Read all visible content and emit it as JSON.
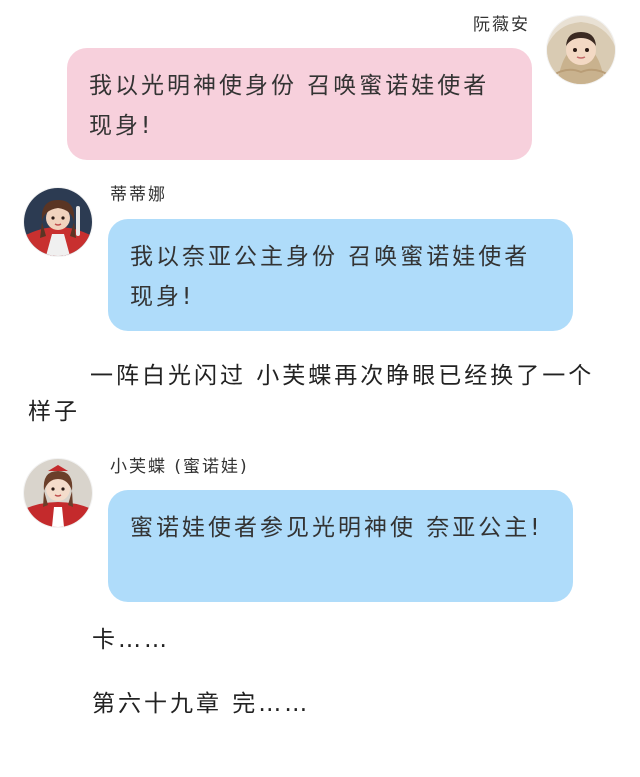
{
  "messages": [
    {
      "sender": "阮薇安",
      "text": "我以光明神使身份 召唤蜜诺娃使者现身!",
      "color": "#f7d0dc"
    },
    {
      "sender": "蒂蒂娜",
      "text": "我以奈亚公主身份 召唤蜜诺娃使者现身!",
      "color": "#afdcfa"
    },
    {
      "sender": "小芙蝶 (蜜诺娃)",
      "text": "蜜诺娃使者参见光明神使 奈亚公主!",
      "color": "#afdcfa"
    }
  ],
  "narration": {
    "transformation": "一阵白光闪过 小芙蝶再次睁眼已经换了一个样子",
    "cut": "卡……",
    "chapter_end": "第六十九章 完……"
  },
  "icons": {
    "avatar_1": "avatar-girl-blanket",
    "avatar_2": "avatar-girl-red-costume",
    "avatar_3": "avatar-girl-red-uniform"
  }
}
